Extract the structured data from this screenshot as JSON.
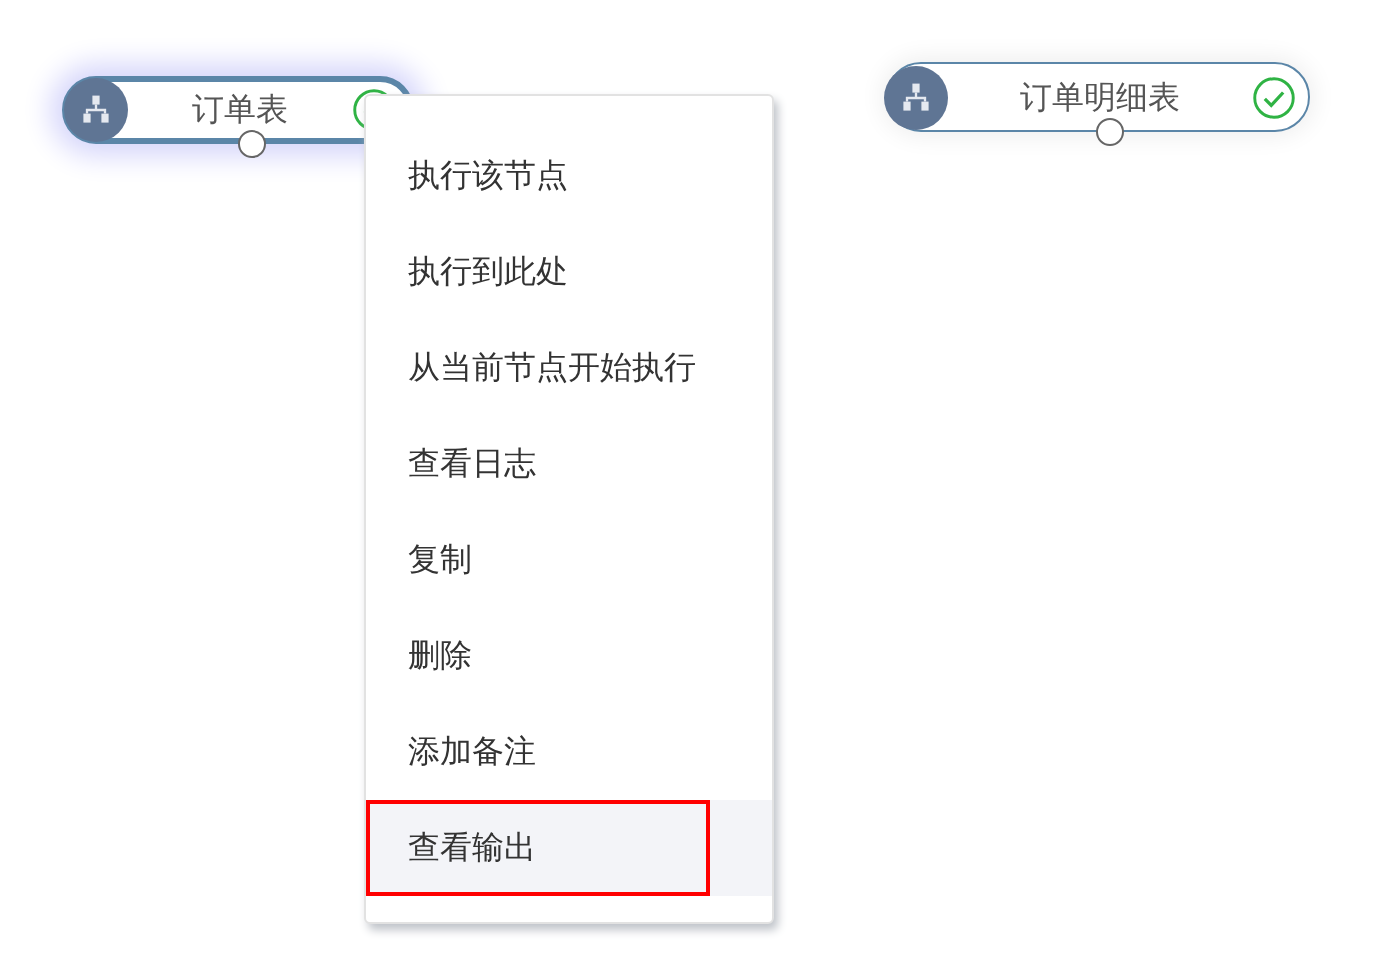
{
  "nodes": [
    {
      "label": "订单表",
      "selected": true,
      "succeeded": true
    },
    {
      "label": "订单明细表",
      "selected": false,
      "succeeded": true
    }
  ],
  "context_menu": {
    "items": [
      {
        "label": "执行该节点",
        "highlighted": false
      },
      {
        "label": "执行到此处",
        "highlighted": false
      },
      {
        "label": "从当前节点开始执行",
        "highlighted": false
      },
      {
        "label": "查看日志",
        "highlighted": false
      },
      {
        "label": "复制",
        "highlighted": false
      },
      {
        "label": "删除",
        "highlighted": false
      },
      {
        "label": "添加备注",
        "highlighted": false
      },
      {
        "label": "查看输出",
        "highlighted": true
      }
    ]
  }
}
